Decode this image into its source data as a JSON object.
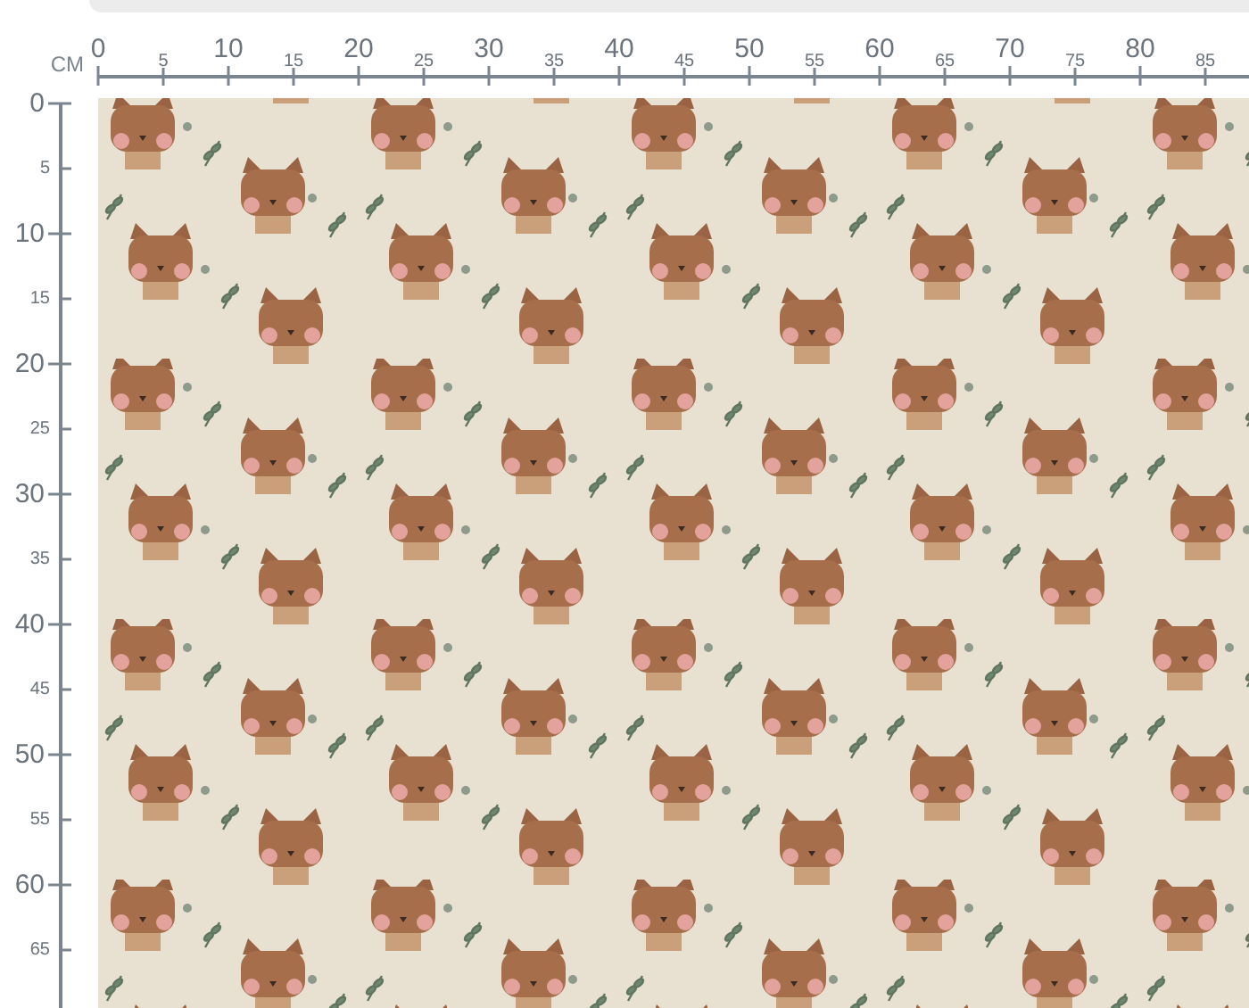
{
  "unit": "CM",
  "top_ruler": {
    "labels": [
      {
        "text": "0",
        "kind": "major"
      },
      {
        "text": "5",
        "kind": "minor"
      },
      {
        "text": "10",
        "kind": "major"
      },
      {
        "text": "15",
        "kind": "minor"
      },
      {
        "text": "20",
        "kind": "major"
      },
      {
        "text": "25",
        "kind": "minor"
      },
      {
        "text": "30",
        "kind": "major"
      },
      {
        "text": "35",
        "kind": "minor"
      },
      {
        "text": "40",
        "kind": "major"
      },
      {
        "text": "45",
        "kind": "minor"
      },
      {
        "text": "50",
        "kind": "major"
      },
      {
        "text": "55",
        "kind": "minor"
      },
      {
        "text": "60",
        "kind": "major"
      },
      {
        "text": "65",
        "kind": "minor"
      },
      {
        "text": "70",
        "kind": "major"
      },
      {
        "text": "75",
        "kind": "minor"
      },
      {
        "text": "80",
        "kind": "major"
      },
      {
        "text": "85",
        "kind": "minor"
      }
    ]
  },
  "left_ruler": {
    "labels": [
      {
        "text": "0",
        "kind": "major"
      },
      {
        "text": "5",
        "kind": "minor"
      },
      {
        "text": "10",
        "kind": "major"
      },
      {
        "text": "15",
        "kind": "minor"
      },
      {
        "text": "20",
        "kind": "major"
      },
      {
        "text": "25",
        "kind": "minor"
      },
      {
        "text": "30",
        "kind": "major"
      },
      {
        "text": "35",
        "kind": "minor"
      },
      {
        "text": "40",
        "kind": "major"
      },
      {
        "text": "45",
        "kind": "minor"
      },
      {
        "text": "50",
        "kind": "major"
      },
      {
        "text": "55",
        "kind": "minor"
      },
      {
        "text": "60",
        "kind": "major"
      },
      {
        "text": "65",
        "kind": "minor"
      }
    ]
  }
}
